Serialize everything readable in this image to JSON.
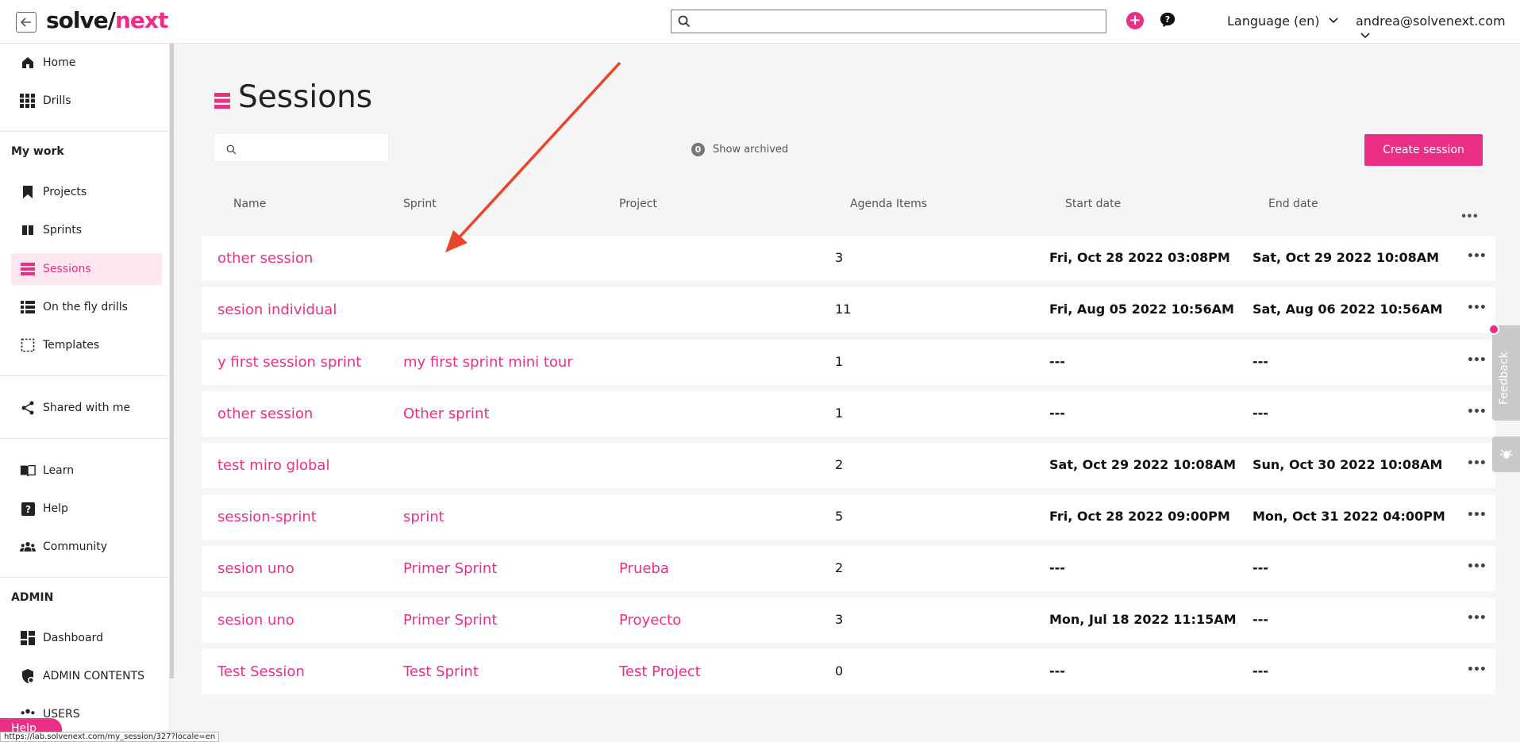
{
  "topbar": {
    "logo_part1": "solve/",
    "logo_part2": "next",
    "search_placeholder": "",
    "language_label": "Language (en)",
    "user_email": "andrea@solvenext.com"
  },
  "sidebar": {
    "home": "Home",
    "drills": "Drills",
    "my_work_title": "My work",
    "projects": "Projects",
    "sprints": "Sprints",
    "sessions": "Sessions",
    "on_the_fly": "On the fly drills",
    "templates": "Templates",
    "shared": "Shared with me",
    "learn": "Learn",
    "help": "Help",
    "community": "Community",
    "admin_title": "ADMIN",
    "dashboard": "Dashboard",
    "admin_contents": "ADMIN CONTENTS",
    "users": "USERS",
    "help_pill": "Help"
  },
  "status_url": "https://lab.solvenext.com/my_session/327?locale=en",
  "main": {
    "title": "Sessions",
    "archived_count": "0",
    "show_archived": "Show archived",
    "create_button": "Create session",
    "columns": {
      "name": "Name",
      "sprint": "Sprint",
      "project": "Project",
      "agenda": "Agenda Items",
      "start": "Start date",
      "end": "End date"
    },
    "rows": [
      {
        "name": "other session",
        "sprint": "",
        "project": "",
        "agenda": "3",
        "start": "Fri, Oct 28 2022 03:08PM",
        "end": "Sat, Oct 29 2022 10:08AM"
      },
      {
        "name": "sesion individual",
        "sprint": "",
        "project": "",
        "agenda": "11",
        "start": "Fri, Aug 05 2022 10:56AM",
        "end": "Sat, Aug 06 2022 10:56AM"
      },
      {
        "name": "y first session sprint",
        "sprint": "my first sprint mini tour",
        "project": "",
        "agenda": "1",
        "start": "---",
        "end": "---"
      },
      {
        "name": "other session",
        "sprint": "Other sprint",
        "project": "",
        "agenda": "1",
        "start": "---",
        "end": "---"
      },
      {
        "name": "test miro global",
        "sprint": "",
        "project": "",
        "agenda": "2",
        "start": "Sat, Oct 29 2022 10:08AM",
        "end": "Sun, Oct 30 2022 10:08AM"
      },
      {
        "name": "session-sprint",
        "sprint": "sprint",
        "project": "",
        "agenda": "5",
        "start": "Fri, Oct 28 2022 09:00PM",
        "end": "Mon, Oct 31 2022 04:00PM"
      },
      {
        "name": "sesion uno",
        "sprint": "Primer Sprint",
        "project": "Prueba",
        "agenda": "2",
        "start": "---",
        "end": "---"
      },
      {
        "name": "sesion uno",
        "sprint": "Primer Sprint",
        "project": "Proyecto",
        "agenda": "3",
        "start": "Mon, Jul 18 2022 11:15AM",
        "end": "---"
      },
      {
        "name": "Test Session",
        "sprint": "Test Sprint",
        "project": "Test Project",
        "agenda": "0",
        "start": "---",
        "end": "---"
      }
    ]
  },
  "feedback_label": "Feedback",
  "colors": {
    "accent": "#ec2f86",
    "annotation_arrow": "#e8452c"
  }
}
